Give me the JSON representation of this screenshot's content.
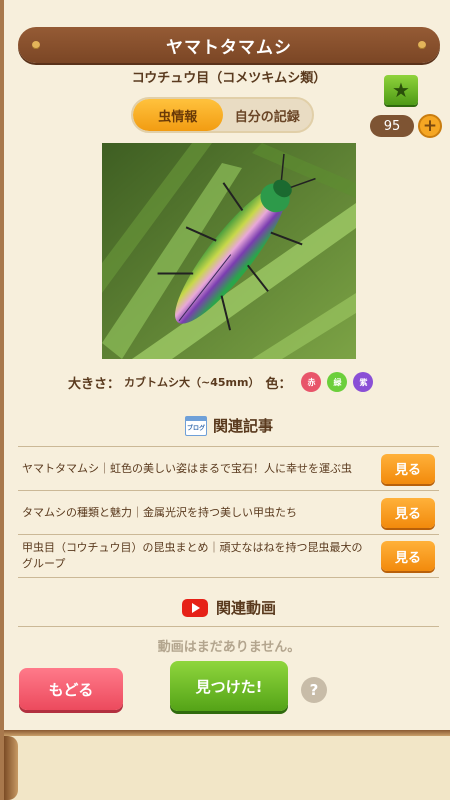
{
  "header": {
    "title": "ヤマトタマムシ"
  },
  "category": "コウチュウ目（コメツキムシ類）",
  "stats": {
    "star_icon": "star-icon",
    "count": "95",
    "plus": "+"
  },
  "tabs": [
    {
      "label": "虫情報",
      "active": true
    },
    {
      "label": "自分の記録",
      "active": false
    }
  ],
  "info": {
    "size_label": "大きさ：",
    "size_value": "カブトムシ大（~45mm）",
    "color_label": "色：",
    "colors": [
      {
        "label": "赤",
        "hex": "#e8556a"
      },
      {
        "label": "緑",
        "hex": "#6ccf3b"
      },
      {
        "label": "紫",
        "hex": "#8a4fd6"
      }
    ]
  },
  "articles_section": {
    "icon_text": "ブログ",
    "title": "関連記事",
    "items": [
      {
        "text": "ヤマトタマムシ｜虹色の美しい姿はまるで宝石！人に幸せを運ぶ虫",
        "button": "見る"
      },
      {
        "text": "タマムシの種類と魅力｜金属光沢を持つ美しい甲虫たち",
        "button": "見る"
      },
      {
        "text": "甲虫目（コウチュウ目）の昆虫まとめ｜頑丈なはねを持つ昆虫最大のグループ",
        "button": "見る"
      }
    ]
  },
  "videos_section": {
    "title": "関連動画",
    "empty_text": "動画はまだありません。"
  },
  "footer": {
    "back_label": "もどる",
    "found_label": "見つけた!",
    "help_label": "?"
  }
}
